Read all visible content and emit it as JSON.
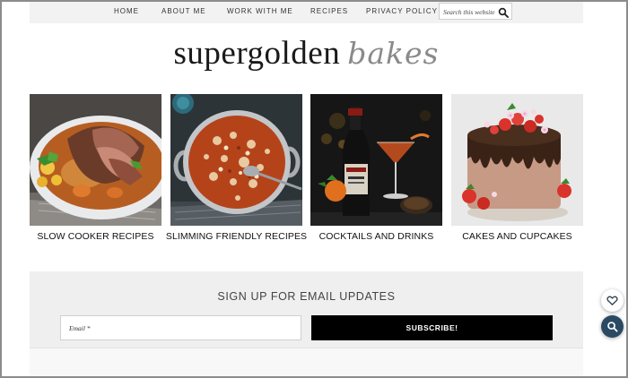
{
  "nav": {
    "items": [
      {
        "label": "HOME"
      },
      {
        "label": "ABOUT ME"
      },
      {
        "label": "WORK WITH ME"
      },
      {
        "label": "RECIPES"
      },
      {
        "label": "PRIVACY POLICY"
      }
    ],
    "search": {
      "placeholder": "Search this website",
      "icon": "search-icon"
    }
  },
  "logo": {
    "main": "supergolden",
    "accent": "bakes"
  },
  "categories": [
    {
      "label": "SLOW COOKER RECIPES",
      "image": "slow-cooker-beef-dish"
    },
    {
      "label": "SLIMMING FRIENDLY RECIPES",
      "image": "casserole-pan-dish"
    },
    {
      "label": "COCKTAILS AND DRINKS",
      "image": "cocktail-and-bottle"
    },
    {
      "label": "CAKES AND CUPCAKES",
      "image": "chocolate-drip-cake"
    }
  ],
  "signup": {
    "title": "SIGN UP FOR EMAIL UPDATES",
    "email_placeholder": "Email *",
    "button_label": "SUBSCRIBE!"
  },
  "floating": {
    "favorite_icon": "heart-icon",
    "search_icon": "search-icon"
  },
  "colors": {
    "nav_bg": "#f2f2f2",
    "signup_bg": "#efefef",
    "button_bg": "#000000",
    "fab_search_bg": "#2a4a63",
    "logo_accent": "#8a8a8a"
  }
}
